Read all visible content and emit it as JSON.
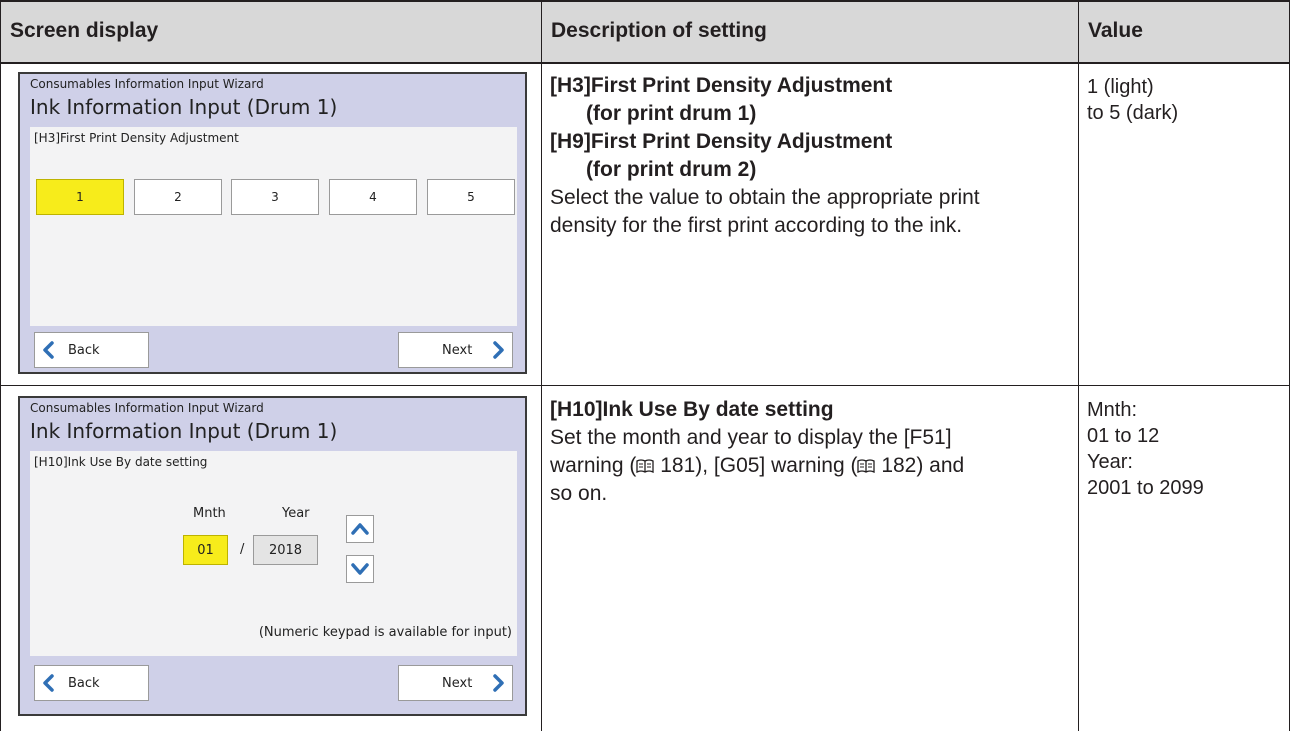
{
  "table": {
    "headers": {
      "screen": "Screen display",
      "description": "Description of setting",
      "value": "Value"
    },
    "rows": [
      {
        "screen": {
          "wizard": "Consumables Information Input Wizard",
          "title": "Ink Information Input (Drum 1)",
          "setting_label": "[H3]First Print Density Adjustment",
          "options": [
            "1",
            "2",
            "3",
            "4",
            "5"
          ],
          "selected": "1",
          "back_label": "Back",
          "next_label": "Next"
        },
        "description": {
          "h3_title": "[H3]First Print Density Adjustment",
          "h3_sub": "(for print drum 1)",
          "h9_title": "[H9]First Print Density Adjustment",
          "h9_sub": "(for print drum 2)",
          "body_line1": "Select the value to obtain the appropriate print",
          "body_line2": "density for the first print according to the ink."
        },
        "value": {
          "line1": "1 (light)",
          "line2": "to 5 (dark)"
        }
      },
      {
        "screen": {
          "wizard": "Consumables Information Input Wizard",
          "title": "Ink Information Input (Drum 1)",
          "setting_label": "[H10]Ink Use By date setting",
          "month_label": "Mnth",
          "year_label": "Year",
          "month_value": "01",
          "separator": "/",
          "year_value": "2018",
          "keypad_note": "(Numeric keypad is available for input)",
          "back_label": "Back",
          "next_label": "Next"
        },
        "description": {
          "title": "[H10]Ink Use By date setting",
          "line1": "Set the month and year to display the [F51]",
          "line2_a": "warning (",
          "line2_ref1": " 181), [G05] warning (",
          "line2_ref2": " 182) and",
          "line3": "so on."
        },
        "value": {
          "line1": "Mnth:",
          "line2": "01 to 12",
          "line3": "Year:",
          "line4": "2001 to 2099"
        }
      }
    ]
  },
  "colors": {
    "header_bg": "#d8d8d8",
    "screen_bg": "#cfd0e8",
    "selected_yellow": "#f7ec1b",
    "arrow_blue": "#2f6fb5"
  }
}
